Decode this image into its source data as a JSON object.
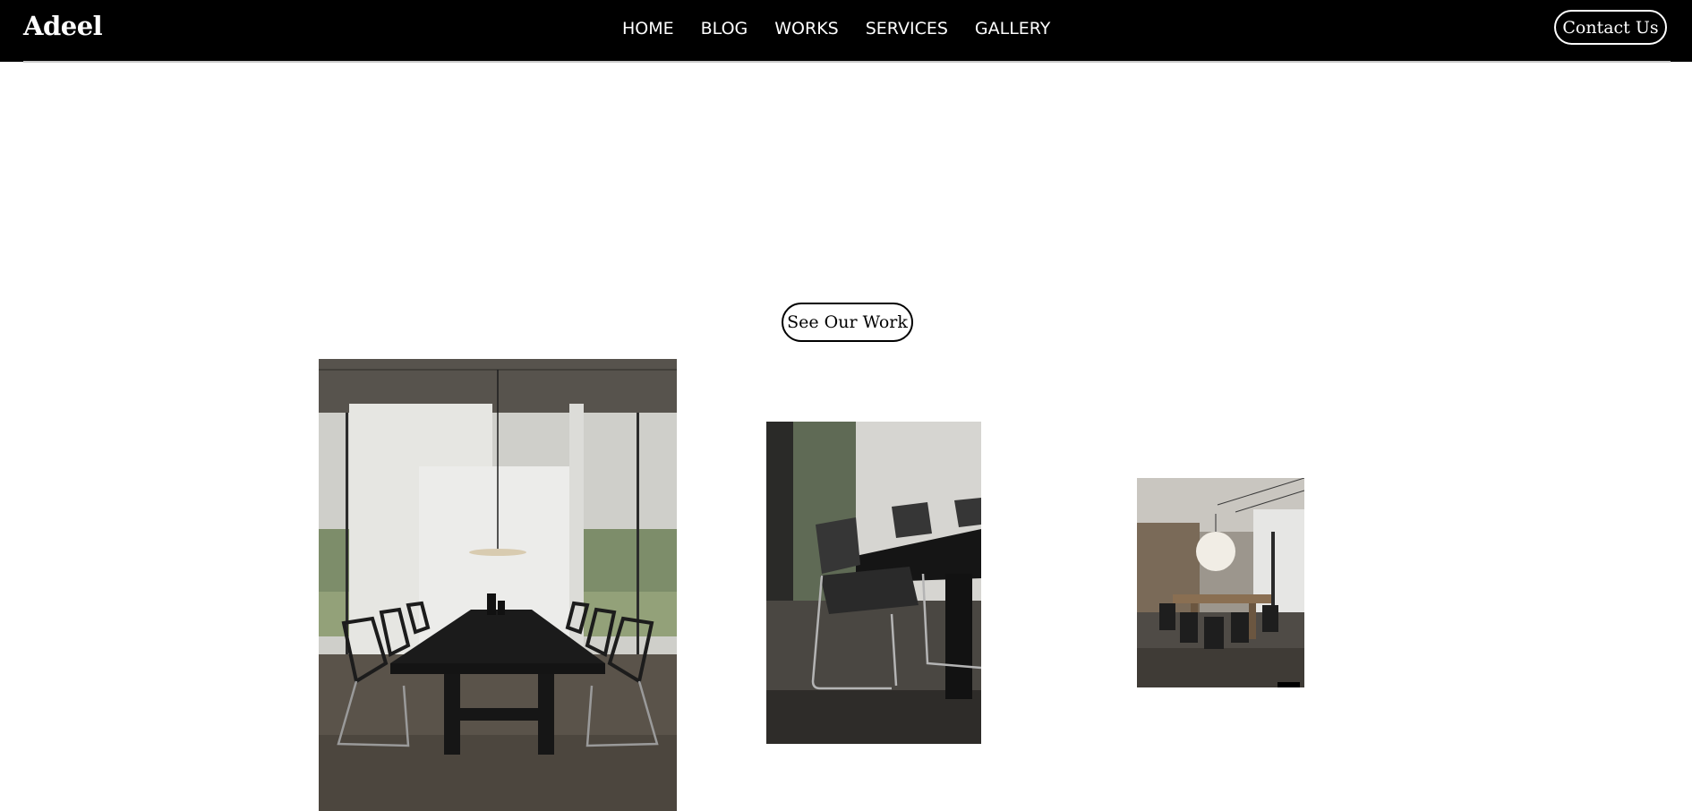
{
  "header": {
    "logo": "Adeel",
    "nav": [
      "HOME",
      "BLOG",
      "WORKS",
      "SERVICES",
      "GALLERY"
    ],
    "contact_label": "Contact Us"
  },
  "hero": {
    "cta_label": "See Our Work"
  },
  "gallery": {
    "photos": [
      "dining-room-photo",
      "chair-closeup-photo",
      "dining-room-wood-photo"
    ]
  }
}
